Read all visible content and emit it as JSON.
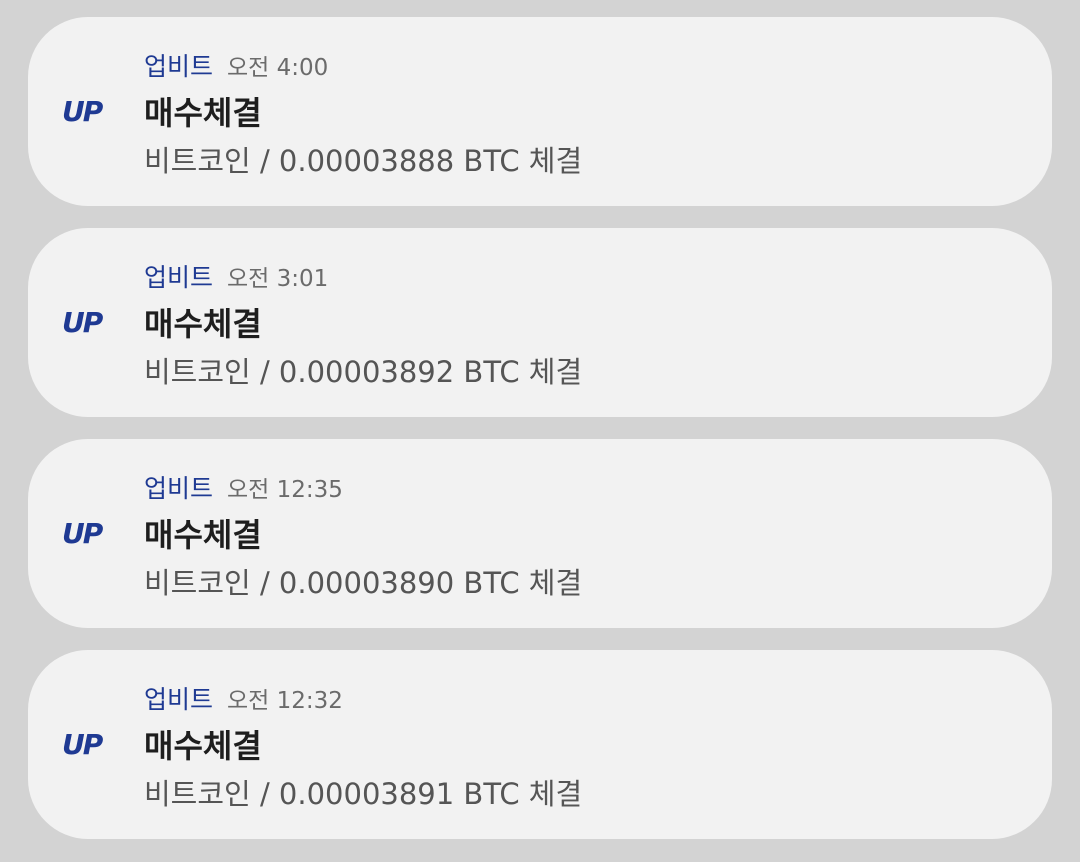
{
  "notifications": [
    {
      "app_name": "업비트",
      "time": "오전 4:00",
      "title": "매수체결",
      "body": "비트코인 / 0.00003888 BTC 체결",
      "icon": "upbit-logo-icon"
    },
    {
      "app_name": "업비트",
      "time": "오전 3:01",
      "title": "매수체결",
      "body": "비트코인 / 0.00003892 BTC 체결",
      "icon": "upbit-logo-icon"
    },
    {
      "app_name": "업비트",
      "time": "오전 12:35",
      "title": "매수체결",
      "body": "비트코인 / 0.00003890 BTC 체결",
      "icon": "upbit-logo-icon"
    },
    {
      "app_name": "업비트",
      "time": "오전 12:32",
      "title": "매수체결",
      "body": "비트코인 / 0.00003891 BTC 체결",
      "icon": "upbit-logo-icon"
    }
  ],
  "colors": {
    "background": "#d3d3d3",
    "card": "#f2f2f2",
    "brand": "#1f3a93",
    "title": "#1e1e1e",
    "body": "#555555"
  }
}
